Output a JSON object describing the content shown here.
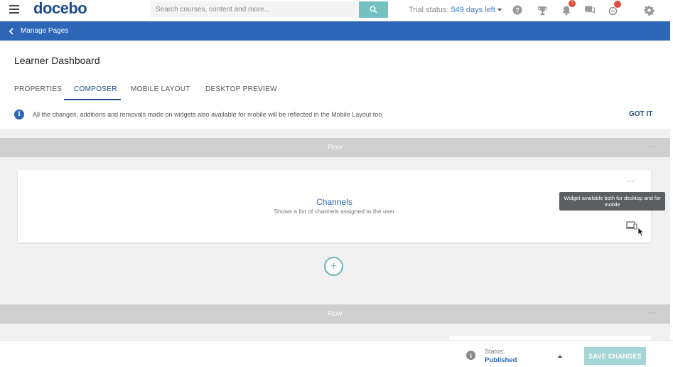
{
  "topbar": {
    "logo": "docebo",
    "search_placeholder": "Search courses, content and more...",
    "trial_prefix": "Trial status:",
    "trial_days": "549 days left",
    "notifications_count": "7"
  },
  "nav": {
    "back_label": "Manage Pages"
  },
  "page": {
    "title": "Learner Dashboard",
    "tabs": [
      {
        "label": "PROPERTIES"
      },
      {
        "label": "COMPOSER"
      },
      {
        "label": "MOBILE LAYOUT"
      },
      {
        "label": "DESKTOP PREVIEW"
      }
    ],
    "info_text": "All the changes, additions and removals made on widgets also available for mobile will be reflected in the Mobile Layout too.",
    "got_it": "GOT IT"
  },
  "rows": [
    {
      "label": "Row",
      "more": "···",
      "widget": {
        "title": "Channels",
        "description": "Shows a list of channels assigned to the user",
        "more": "···",
        "tooltip": "Widget available both for desktop and for mobile"
      },
      "add_label": "+"
    },
    {
      "label": "Row",
      "more": "···"
    }
  ],
  "footer": {
    "status_label": "Status:",
    "status_value": "Published",
    "save_label": "SAVE CHANGES"
  },
  "colors": {
    "brand_blue": "#2d65b7",
    "accent_teal": "#74c1c1",
    "badge_red": "#e14b3b"
  }
}
